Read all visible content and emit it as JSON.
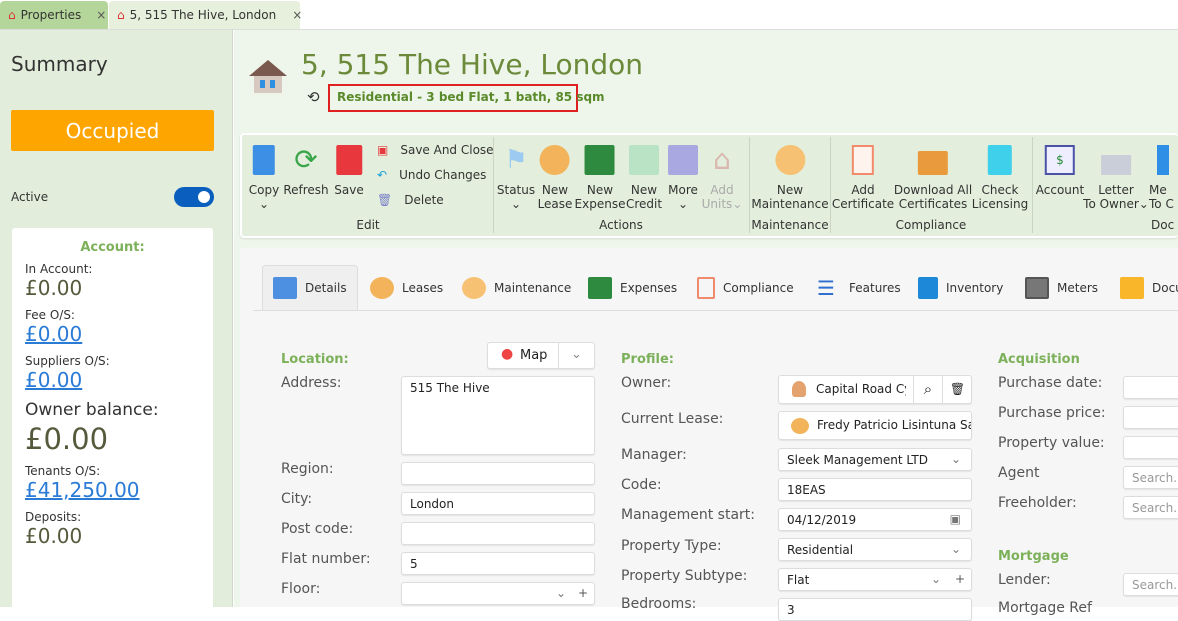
{
  "tabs": [
    {
      "label": "Properties",
      "close": "×"
    },
    {
      "label": "5, 515 The Hive, London",
      "close": "×",
      "modified": true
    }
  ],
  "sidebar": {
    "title": "Summary",
    "status": "Occupied",
    "active_label": "Active",
    "active": true,
    "account": {
      "title": "Account:",
      "in_account_label": "In Account:",
      "in_account": "£0.00",
      "fee_label": "Fee O/S:",
      "fee": "£0.00",
      "suppliers_label": "Suppliers O/S:",
      "suppliers": "£0.00",
      "owner_label": "Owner balance:",
      "owner": "£0.00",
      "tenants_label": "Tenants O/S:",
      "tenants": "£41,250.00",
      "deposits_label": "Deposits:",
      "deposits": "£0.00"
    }
  },
  "header": {
    "title": "5, 515 The Hive, London",
    "subtitle": "Residential - 3 bed Flat, 1 bath, 85 sqm"
  },
  "ribbon": {
    "edit": {
      "label": "Edit",
      "copy": "Copy",
      "refresh": "Refresh",
      "save": "Save",
      "save_close": "Save And Close",
      "undo": "Undo Changes",
      "delete": "Delete"
    },
    "actions": {
      "label": "Actions",
      "status": "Status",
      "new_lease": [
        "New",
        "Lease"
      ],
      "new_expense": [
        "New",
        "Expense"
      ],
      "new_credit": [
        "New",
        "Credit"
      ],
      "more": "More",
      "add_units": [
        "Add",
        "Units"
      ]
    },
    "maintenance": {
      "label": "Maintenance",
      "new": [
        "New",
        "Maintenance"
      ]
    },
    "compliance": {
      "label": "Compliance",
      "add": [
        "Add",
        "Certificate"
      ],
      "download": [
        "Download All",
        "Certificates"
      ],
      "check": [
        "Check",
        "Licensing"
      ]
    },
    "documents": {
      "label": "Doc",
      "account": "Account",
      "letter": [
        "Letter",
        "To Owner"
      ],
      "message": [
        "Me",
        "To C"
      ]
    }
  },
  "page_tabs": [
    "Details",
    "Leases",
    "Maintenance",
    "Expenses",
    "Compliance",
    "Features",
    "Inventory",
    "Meters",
    "Docu"
  ],
  "location": {
    "title": "Location:",
    "map": "Map",
    "address_label": "Address:",
    "address": "515 The Hive",
    "region_label": "Region:",
    "region": "",
    "city_label": "City:",
    "city": "London",
    "postcode_label": "Post code:",
    "postcode": "",
    "flat_label": "Flat number:",
    "flat": "5",
    "floor_label": "Floor:",
    "floor": ""
  },
  "profile": {
    "title": "Profile:",
    "owner_label": "Owner:",
    "owner": "Capital Road Cyc",
    "lease_label": "Current Lease:",
    "lease": "Fredy Patricio Lisintuna Sag",
    "manager_label": "Manager:",
    "manager": "Sleek Management LTD",
    "code_label": "Code:",
    "code": "18EAS",
    "mstart_label": "Management start:",
    "mstart": "04/12/2019",
    "ptype_label": "Property Type:",
    "ptype": "Residential",
    "psub_label": "Property Subtype:",
    "psub": "Flat",
    "bedrooms_label": "Bedrooms:",
    "bedrooms": "3"
  },
  "acquisition": {
    "title": "Acquisition",
    "pdate_label": "Purchase date:",
    "pprice_label": "Purchase price:",
    "pvalue_label": "Property value:",
    "agent_label": "Agent",
    "freeholder_label": "Freeholder:",
    "search_placeholder": "Search..."
  },
  "mortgage": {
    "title": "Mortgage",
    "lender_label": "Lender:",
    "ref_label": "Mortgage Ref"
  }
}
